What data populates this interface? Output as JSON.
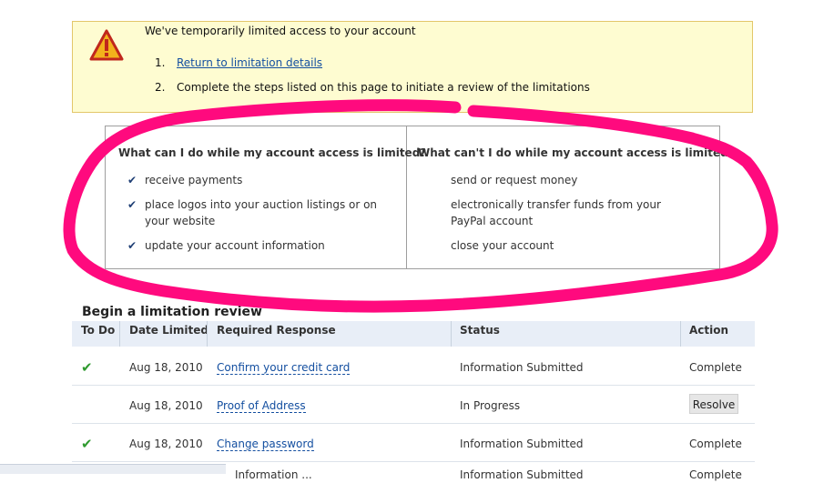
{
  "alert": {
    "title": "We've temporarily limited access to your account",
    "steps": [
      {
        "num": "1.",
        "text": "Return to limitation details"
      },
      {
        "num": "2.",
        "text": "Complete the steps listed on this page to initiate a review of the limitations"
      }
    ]
  },
  "limits": {
    "can_heading": "What can I do while my account access is limited?",
    "can_items": [
      "receive payments",
      "place logos into your auction listings or on your website",
      "update your account information"
    ],
    "cant_heading": "What can't I do while my account access is limited?",
    "cant_items": [
      "send or request money",
      "electronically transfer funds from your PayPal account",
      "close your account"
    ]
  },
  "review": {
    "title": "Begin a limitation review",
    "headers": {
      "todo": "To Do",
      "date": "Date Limited",
      "response": "Required Response",
      "status": "Status",
      "action": "Action"
    },
    "rows": [
      {
        "date": "Aug 18, 2010",
        "response": "Confirm your credit card",
        "status": "Information Submitted",
        "action": "Complete"
      },
      {
        "date": "Aug 18, 2010",
        "response": "Proof of Address",
        "status": "In Progress",
        "action": "Resolve"
      },
      {
        "date": "Aug 18, 2010",
        "response": "Change password",
        "status": "Information Submitted",
        "action": "Complete"
      }
    ],
    "partial_row": {
      "response": "Information ...",
      "status": "Information Submitted",
      "action": "Complete"
    }
  },
  "colors": {
    "alert_bg": "#fefcd1",
    "marker": "#ff0a7e",
    "link": "#144fa0",
    "check_green": "#2f9a2f"
  }
}
